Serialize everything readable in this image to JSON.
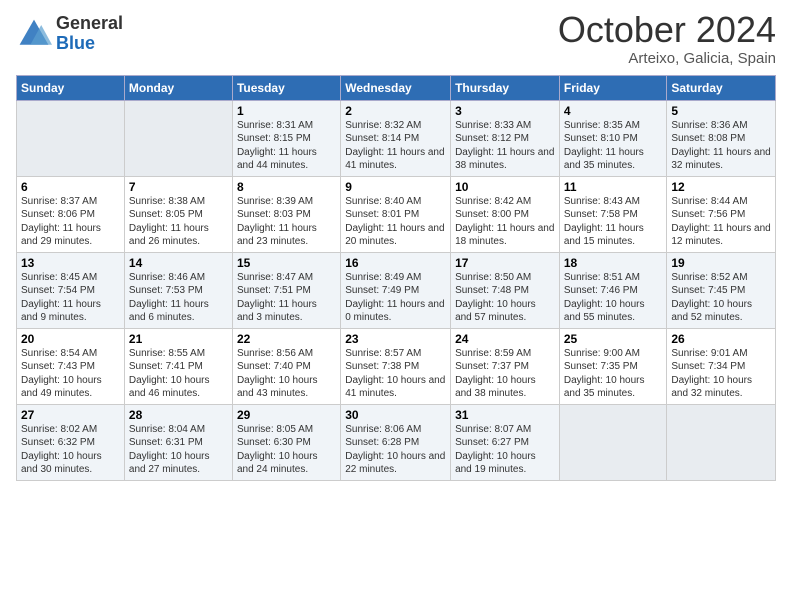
{
  "header": {
    "logo_general": "General",
    "logo_blue": "Blue",
    "month": "October 2024",
    "location": "Arteixo, Galicia, Spain"
  },
  "weekdays": [
    "Sunday",
    "Monday",
    "Tuesday",
    "Wednesday",
    "Thursday",
    "Friday",
    "Saturday"
  ],
  "weeks": [
    [
      {
        "day": "",
        "empty": true
      },
      {
        "day": "",
        "empty": true
      },
      {
        "day": "1",
        "sunrise": "8:31 AM",
        "sunset": "8:15 PM",
        "daylight": "11 hours and 44 minutes."
      },
      {
        "day": "2",
        "sunrise": "8:32 AM",
        "sunset": "8:14 PM",
        "daylight": "11 hours and 41 minutes."
      },
      {
        "day": "3",
        "sunrise": "8:33 AM",
        "sunset": "8:12 PM",
        "daylight": "11 hours and 38 minutes."
      },
      {
        "day": "4",
        "sunrise": "8:35 AM",
        "sunset": "8:10 PM",
        "daylight": "11 hours and 35 minutes."
      },
      {
        "day": "5",
        "sunrise": "8:36 AM",
        "sunset": "8:08 PM",
        "daylight": "11 hours and 32 minutes."
      }
    ],
    [
      {
        "day": "6",
        "sunrise": "8:37 AM",
        "sunset": "8:06 PM",
        "daylight": "11 hours and 29 minutes."
      },
      {
        "day": "7",
        "sunrise": "8:38 AM",
        "sunset": "8:05 PM",
        "daylight": "11 hours and 26 minutes."
      },
      {
        "day": "8",
        "sunrise": "8:39 AM",
        "sunset": "8:03 PM",
        "daylight": "11 hours and 23 minutes."
      },
      {
        "day": "9",
        "sunrise": "8:40 AM",
        "sunset": "8:01 PM",
        "daylight": "11 hours and 20 minutes."
      },
      {
        "day": "10",
        "sunrise": "8:42 AM",
        "sunset": "8:00 PM",
        "daylight": "11 hours and 18 minutes."
      },
      {
        "day": "11",
        "sunrise": "8:43 AM",
        "sunset": "7:58 PM",
        "daylight": "11 hours and 15 minutes."
      },
      {
        "day": "12",
        "sunrise": "8:44 AM",
        "sunset": "7:56 PM",
        "daylight": "11 hours and 12 minutes."
      }
    ],
    [
      {
        "day": "13",
        "sunrise": "8:45 AM",
        "sunset": "7:54 PM",
        "daylight": "11 hours and 9 minutes."
      },
      {
        "day": "14",
        "sunrise": "8:46 AM",
        "sunset": "7:53 PM",
        "daylight": "11 hours and 6 minutes."
      },
      {
        "day": "15",
        "sunrise": "8:47 AM",
        "sunset": "7:51 PM",
        "daylight": "11 hours and 3 minutes."
      },
      {
        "day": "16",
        "sunrise": "8:49 AM",
        "sunset": "7:49 PM",
        "daylight": "11 hours and 0 minutes."
      },
      {
        "day": "17",
        "sunrise": "8:50 AM",
        "sunset": "7:48 PM",
        "daylight": "10 hours and 57 minutes."
      },
      {
        "day": "18",
        "sunrise": "8:51 AM",
        "sunset": "7:46 PM",
        "daylight": "10 hours and 55 minutes."
      },
      {
        "day": "19",
        "sunrise": "8:52 AM",
        "sunset": "7:45 PM",
        "daylight": "10 hours and 52 minutes."
      }
    ],
    [
      {
        "day": "20",
        "sunrise": "8:54 AM",
        "sunset": "7:43 PM",
        "daylight": "10 hours and 49 minutes."
      },
      {
        "day": "21",
        "sunrise": "8:55 AM",
        "sunset": "7:41 PM",
        "daylight": "10 hours and 46 minutes."
      },
      {
        "day": "22",
        "sunrise": "8:56 AM",
        "sunset": "7:40 PM",
        "daylight": "10 hours and 43 minutes."
      },
      {
        "day": "23",
        "sunrise": "8:57 AM",
        "sunset": "7:38 PM",
        "daylight": "10 hours and 41 minutes."
      },
      {
        "day": "24",
        "sunrise": "8:59 AM",
        "sunset": "7:37 PM",
        "daylight": "10 hours and 38 minutes."
      },
      {
        "day": "25",
        "sunrise": "9:00 AM",
        "sunset": "7:35 PM",
        "daylight": "10 hours and 35 minutes."
      },
      {
        "day": "26",
        "sunrise": "9:01 AM",
        "sunset": "7:34 PM",
        "daylight": "10 hours and 32 minutes."
      }
    ],
    [
      {
        "day": "27",
        "sunrise": "8:02 AM",
        "sunset": "6:32 PM",
        "daylight": "10 hours and 30 minutes."
      },
      {
        "day": "28",
        "sunrise": "8:04 AM",
        "sunset": "6:31 PM",
        "daylight": "10 hours and 27 minutes."
      },
      {
        "day": "29",
        "sunrise": "8:05 AM",
        "sunset": "6:30 PM",
        "daylight": "10 hours and 24 minutes."
      },
      {
        "day": "30",
        "sunrise": "8:06 AM",
        "sunset": "6:28 PM",
        "daylight": "10 hours and 22 minutes."
      },
      {
        "day": "31",
        "sunrise": "8:07 AM",
        "sunset": "6:27 PM",
        "daylight": "10 hours and 19 minutes."
      },
      {
        "day": "",
        "empty": true
      },
      {
        "day": "",
        "empty": true
      }
    ]
  ],
  "labels": {
    "sunrise": "Sunrise:",
    "sunset": "Sunset:",
    "daylight": "Daylight:"
  }
}
